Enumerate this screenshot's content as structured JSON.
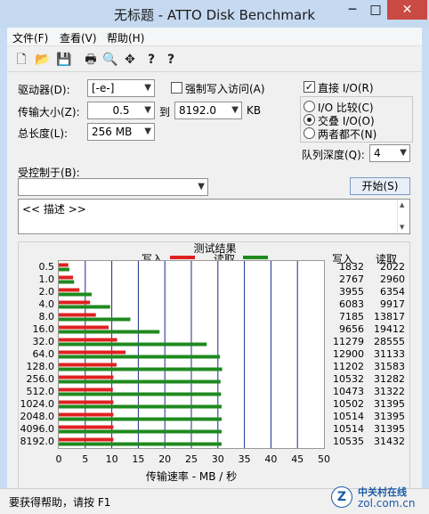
{
  "window": {
    "title": "无标题 - ATTO Disk Benchmark",
    "min": "─",
    "max": "□",
    "close": "✕"
  },
  "menu": [
    {
      "label": "文件(F)"
    },
    {
      "label": "查看(V)"
    },
    {
      "label": "帮助(H)"
    }
  ],
  "toolbar_icons": [
    "new-file-icon",
    "open-folder-icon",
    "save-icon",
    "print-icon",
    "print-preview-icon",
    "move-icon",
    "help-icon",
    "context-help-icon"
  ],
  "toolbar_glyphs": [
    "🗋",
    "📂",
    "💾",
    "🖶",
    "🔍",
    "✥",
    "?",
    "?"
  ],
  "form": {
    "drive_label": "驱动器(D):",
    "drive_value": "[-e-]",
    "force_write_label": "强制写入访问(A)",
    "transfer_label": "传输大小(Z):",
    "transfer_from": "0.5",
    "to_label": "到",
    "transfer_to": "8192.0",
    "kb_label": "KB",
    "total_label": "总长度(L):",
    "total_value": "256 MB",
    "direct_io_label": "直接 I/O(R)",
    "direct_io_checked": "✓",
    "io_compare_label": "I/O 比较(C)",
    "overlap_label": "交叠 I/O(O)",
    "neither_label": "两者都不(N)",
    "queue_label": "队列深度(Q):",
    "queue_value": "4",
    "controlled_by_label": "受控制于(B):",
    "controlled_by_value": "",
    "start_button": "开始(S)",
    "description": "<< 描述 >>"
  },
  "chart_data": {
    "type": "bar",
    "title": "测试结果",
    "legend": {
      "write": "写入",
      "read": "读取"
    },
    "colors": {
      "write": "#e02020",
      "read": "#1f8a1f"
    },
    "xlabel": "传输速率 - MB / 秒",
    "xlim": [
      0,
      50
    ],
    "xticks": [
      "0",
      "5",
      "10",
      "15",
      "20",
      "25",
      "30",
      "35",
      "40",
      "45",
      "50"
    ],
    "col_write": "写入",
    "col_read": "读取",
    "categories": [
      "0.5",
      "1.0",
      "2.0",
      "4.0",
      "8.0",
      "16.0",
      "32.0",
      "64.0",
      "128.0",
      "256.0",
      "512.0",
      "1024.0",
      "2048.0",
      "4096.0",
      "8192.0"
    ],
    "series": [
      {
        "name": "写入",
        "values": [
          1.8,
          2.7,
          3.9,
          5.9,
          7.0,
          9.4,
          11.0,
          12.6,
          10.9,
          10.3,
          10.2,
          10.3,
          10.3,
          10.3,
          10.3
        ]
      },
      {
        "name": "读取",
        "values": [
          2.0,
          2.9,
          6.2,
          9.7,
          13.5,
          19.0,
          27.9,
          30.4,
          30.8,
          30.5,
          30.6,
          30.7,
          30.7,
          30.7,
          30.7
        ]
      }
    ],
    "write_text": [
      "1832",
      "2767",
      "3955",
      "6083",
      "7185",
      "9656",
      "11279",
      "12900",
      "11202",
      "10532",
      "10473",
      "10502",
      "10514",
      "10514",
      "10535"
    ],
    "read_text": [
      "2022",
      "2960",
      "6354",
      "9917",
      "13817",
      "19412",
      "28555",
      "31133",
      "31583",
      "31282",
      "31322",
      "31395",
      "31395",
      "31395",
      "31432"
    ]
  },
  "status": {
    "text": "要获得帮助，请按 F1"
  },
  "watermark": {
    "brand": "中关村在线",
    "site": "zol.com.cn",
    "logo_letter": "Z"
  }
}
